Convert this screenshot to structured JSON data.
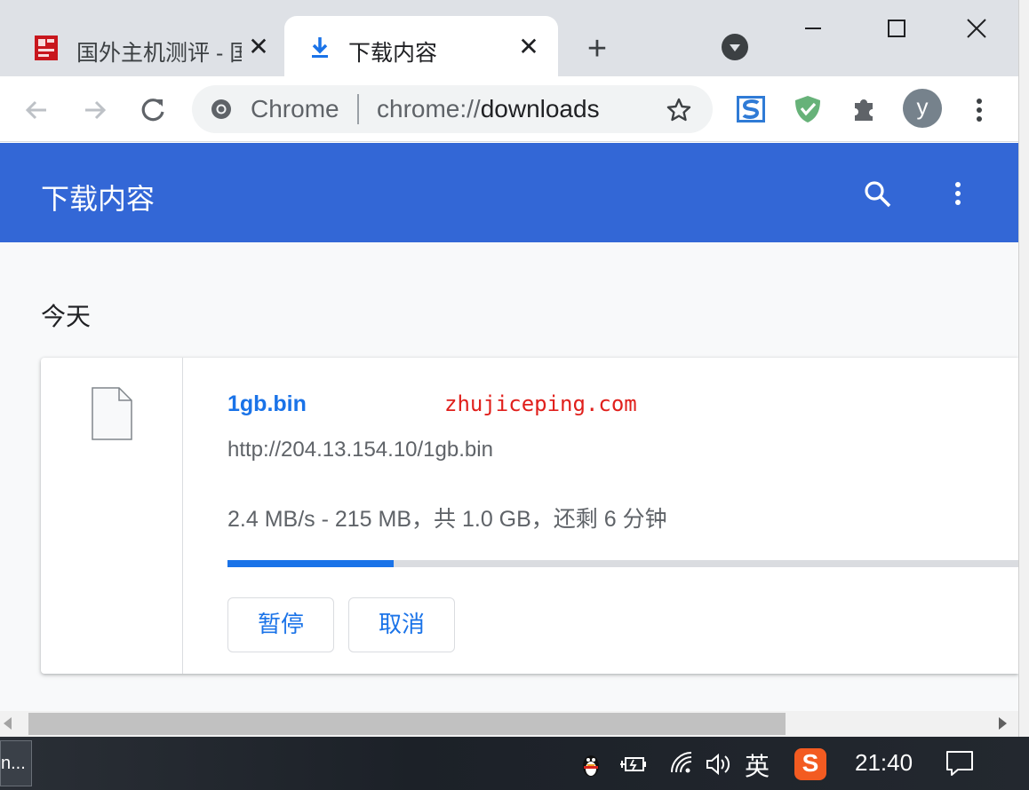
{
  "tabs": [
    {
      "title": "国外主机测评 - 国",
      "active": false
    },
    {
      "title": "下载内容",
      "active": true
    }
  ],
  "omnibox": {
    "origin_label": "Chrome",
    "url_scheme": "chrome://",
    "url_host": "downloads"
  },
  "profile": {
    "initial": "y"
  },
  "downloads": {
    "header_title": "下载内容",
    "day_label": "今天",
    "item": {
      "file_name": "1gb.bin",
      "watermark": "zhujiceping.com",
      "source_url": "http://204.13.154.10/1gb.bin",
      "status": "2.4 MB/s - 215 MB，共 1.0 GB，还剩 6 分钟",
      "progress_percent": 21,
      "pause_label": "暂停",
      "cancel_label": "取消"
    }
  },
  "taskbar": {
    "app_label": "n...",
    "ime_label": "英",
    "sogou_label": "S",
    "time": "21:40"
  },
  "colors": {
    "header_blue": "#3367d6",
    "link_blue": "#1a73e8",
    "watermark_red": "#e0201c"
  },
  "icons": [
    "download-icon",
    "chrome-icon",
    "star-icon",
    "extension-puzzle-icon",
    "shield-check-icon",
    "search-icon",
    "more-vert-icon",
    "file-icon"
  ]
}
